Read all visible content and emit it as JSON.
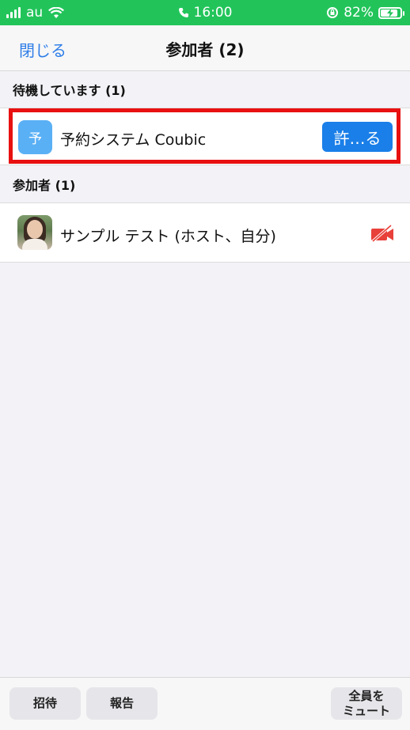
{
  "status_bar": {
    "carrier": "au",
    "time": "16:00",
    "battery_percent": "82%",
    "battery_level": 0.82,
    "background_color": "#22c45a"
  },
  "nav": {
    "close_label": "閉じる",
    "title": "参加者 (2)"
  },
  "waiting_section": {
    "header": "待機しています (1)",
    "items": [
      {
        "avatar_letter": "予",
        "name": "予約システム Coubic",
        "admit_label": "許…る"
      }
    ]
  },
  "participants_section": {
    "header": "参加者 (1)",
    "items": [
      {
        "name": "サンプル テスト (ホスト、自分)",
        "video_icon": "video-off-icon"
      }
    ]
  },
  "toolbar": {
    "invite_label": "招待",
    "report_label": "報告",
    "mute_all_line1": "全員を",
    "mute_all_line2": "ミュート"
  },
  "colors": {
    "accent": "#1a7fe8",
    "link": "#2f7ee8",
    "highlight": "#e81010",
    "video_off": "#e8413a"
  }
}
